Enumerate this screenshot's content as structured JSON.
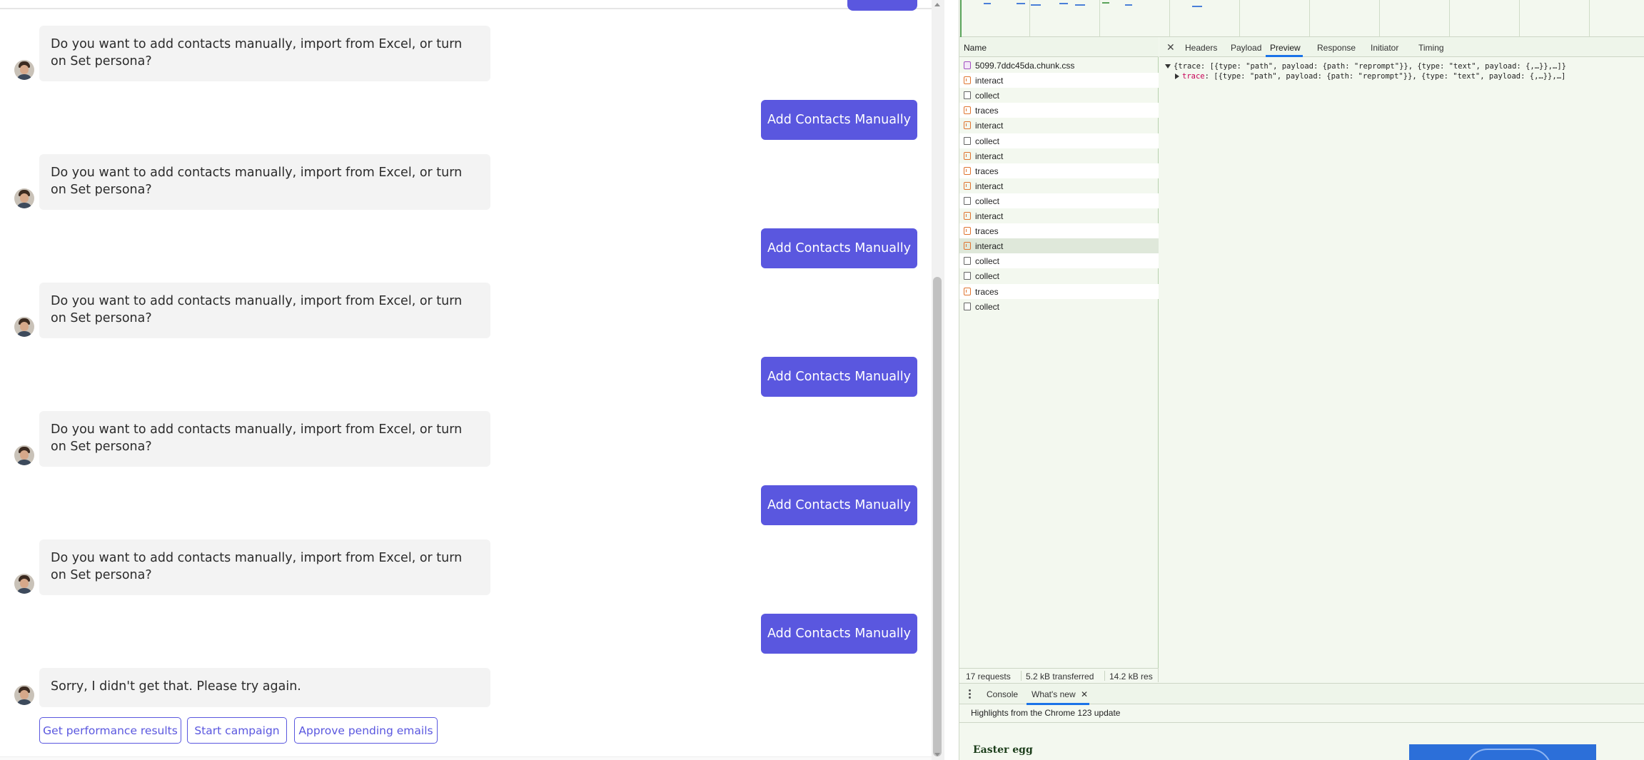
{
  "chat": {
    "bot_messages": [
      "Do you want to add contacts manually, import from Excel, or turn on Set persona?",
      "Do you want to add contacts manually, import from Excel, or turn on Set persona?",
      "Do you want to add contacts manually, import from Excel, or turn on Set persona?",
      "Do you want to add contacts manually, import from Excel, or turn on Set persona?",
      "Do you want to add contacts manually, import from Excel, or turn on Set persona?",
      "Sorry, I didn't get that. Please try again."
    ],
    "user_replies": [
      "Add Contacts Manually",
      "Add Contacts Manually",
      "Add Contacts Manually",
      "Add Contacts Manually",
      "Add Contacts Manually"
    ],
    "quick_replies": [
      "Get performance results",
      "Start campaign",
      "Approve pending emails"
    ],
    "accent_color": "#5a57df"
  },
  "devtools": {
    "name_header": "Name",
    "requests": [
      {
        "name": "5099.7ddc45da.chunk.css",
        "icon": "css-file-icon"
      },
      {
        "name": "interact",
        "icon": "xhr-icon"
      },
      {
        "name": "collect",
        "icon": "document-icon"
      },
      {
        "name": "traces",
        "icon": "xhr-icon"
      },
      {
        "name": "interact",
        "icon": "xhr-icon"
      },
      {
        "name": "collect",
        "icon": "document-icon"
      },
      {
        "name": "interact",
        "icon": "xhr-icon"
      },
      {
        "name": "traces",
        "icon": "xhr-icon"
      },
      {
        "name": "interact",
        "icon": "xhr-icon"
      },
      {
        "name": "collect",
        "icon": "document-icon"
      },
      {
        "name": "interact",
        "icon": "xhr-icon"
      },
      {
        "name": "traces",
        "icon": "xhr-icon"
      },
      {
        "name": "interact",
        "icon": "xhr-icon"
      },
      {
        "name": "collect",
        "icon": "document-icon"
      },
      {
        "name": "collect",
        "icon": "document-icon"
      },
      {
        "name": "traces",
        "icon": "xhr-icon"
      },
      {
        "name": "collect",
        "icon": "document-icon"
      }
    ],
    "detail_tabs": [
      "Headers",
      "Payload",
      "Preview",
      "Response",
      "Initiator",
      "Timing"
    ],
    "active_tab": "Preview",
    "preview": {
      "line1": "{trace: [{type: \"path\", payload: {path: \"reprompt\"}}, {type: \"text\", payload: {,…}},…]}",
      "line2_key": "trace",
      "line2_value": ": [{type: \"path\", payload: {path: \"reprompt\"}}, {type: \"text\", payload: {,…}},…]"
    },
    "status": {
      "requests": "17 requests",
      "transferred": "5.2 kB transferred",
      "resources": "14.2 kB res"
    },
    "drawer": {
      "tabs": [
        "Console",
        "What's new"
      ],
      "active_tab": "What's new",
      "highlights": "Highlights from the Chrome 123 update",
      "easter_egg": "Easter egg"
    }
  }
}
